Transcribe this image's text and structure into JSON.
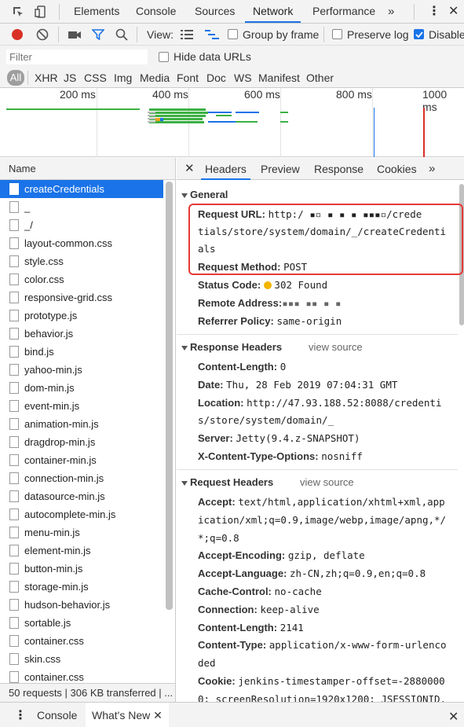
{
  "top_tabs": [
    "Elements",
    "Console",
    "Sources",
    "Network",
    "Performance"
  ],
  "top_active": "Network",
  "toolbar": {
    "view_label": "View:",
    "group_by_frame": "Group by frame",
    "preserve_log": "Preserve log",
    "disable_cache": "Disable"
  },
  "filter": {
    "placeholder": "Filter",
    "hide_data_urls": "Hide data URLs",
    "types": [
      "All",
      "XHR",
      "JS",
      "CSS",
      "Img",
      "Media",
      "Font",
      "Doc",
      "WS",
      "Manifest",
      "Other"
    ]
  },
  "overview": {
    "ticks": [
      "200 ms",
      "400 ms",
      "600 ms",
      "800 ms",
      "1000 ms"
    ]
  },
  "request_list": {
    "header": "Name",
    "items": [
      "createCredentials",
      "_",
      "_/",
      "layout-common.css",
      "style.css",
      "color.css",
      "responsive-grid.css",
      "prototype.js",
      "behavior.js",
      "bind.js",
      "yahoo-min.js",
      "dom-min.js",
      "event-min.js",
      "animation-min.js",
      "dragdrop-min.js",
      "container-min.js",
      "connection-min.js",
      "datasource-min.js",
      "autocomplete-min.js",
      "menu-min.js",
      "element-min.js",
      "button-min.js",
      "storage-min.js",
      "hudson-behavior.js",
      "sortable.js",
      "container.css",
      "skin.css",
      "container.css"
    ],
    "selected": "createCredentials",
    "status": "50 requests | 306 KB transferred | ..."
  },
  "details_tabs": [
    "Headers",
    "Preview",
    "Response",
    "Cookies"
  ],
  "details_active": "Headers",
  "general": {
    "title": "General",
    "request_url_label": "Request URL:",
    "request_url_lines": [
      "http:/ ▪▫ ▪ ▪ ▪ ▪▪▪▫/crede",
      "tials/store/system/domain/_/createCredenti",
      "als"
    ],
    "request_method_label": "Request Method:",
    "request_method": "POST",
    "status_code_label": "Status Code:",
    "status_code": "302 Found",
    "remote_address_label": "Remote Address:",
    "remote_address": "▪▪▪ ▪▪ ▪ ▪",
    "referrer_policy_label": "Referrer Policy:",
    "referrer_policy": "same-origin"
  },
  "response_headers": {
    "title": "Response Headers",
    "view_source": "view source",
    "lines": [
      {
        "k": "Content-Length:",
        "v": "0"
      },
      {
        "k": "Date:",
        "v": "Thu, 28 Feb 2019 07:04:31 GMT"
      },
      {
        "k": "Location:",
        "v": "http://47.93.188.52:8088/credenti"
      },
      {
        "k": "",
        "v": "s/store/system/domain/_"
      },
      {
        "k": "Server:",
        "v": "Jetty(9.4.z-SNAPSHOT)"
      },
      {
        "k": "X-Content-Type-Options:",
        "v": "nosniff"
      }
    ]
  },
  "request_headers": {
    "title": "Request Headers",
    "view_source": "view source",
    "lines": [
      {
        "k": "Accept:",
        "v": "text/html,application/xhtml+xml,app"
      },
      {
        "k": "",
        "v": "ication/xml;q=0.9,image/webp,image/apng,*/"
      },
      {
        "k": "",
        "v": "*;q=0.8"
      },
      {
        "k": "Accept-Encoding:",
        "v": "gzip, deflate"
      },
      {
        "k": "Accept-Language:",
        "v": "zh-CN,zh;q=0.9,en;q=0.8"
      },
      {
        "k": "Cache-Control:",
        "v": "no-cache"
      },
      {
        "k": "Connection:",
        "v": "keep-alive"
      },
      {
        "k": "Content-Length:",
        "v": "2141"
      },
      {
        "k": "Content-Type:",
        "v": "application/x-www-form-urlenco"
      },
      {
        "k": "",
        "v": "ded"
      },
      {
        "k": "Cookie:",
        "v": "jenkins-timestamper-offset=-2880000"
      },
      {
        "k": "",
        "v": "0; screenResolution=1920x1200; JSESSIONID."
      }
    ]
  },
  "drawer": {
    "tabs": [
      "Console",
      "What's New"
    ]
  },
  "colors": {
    "accent": "#1a73e8",
    "highlight": "#e53935",
    "record": "#d93025"
  }
}
